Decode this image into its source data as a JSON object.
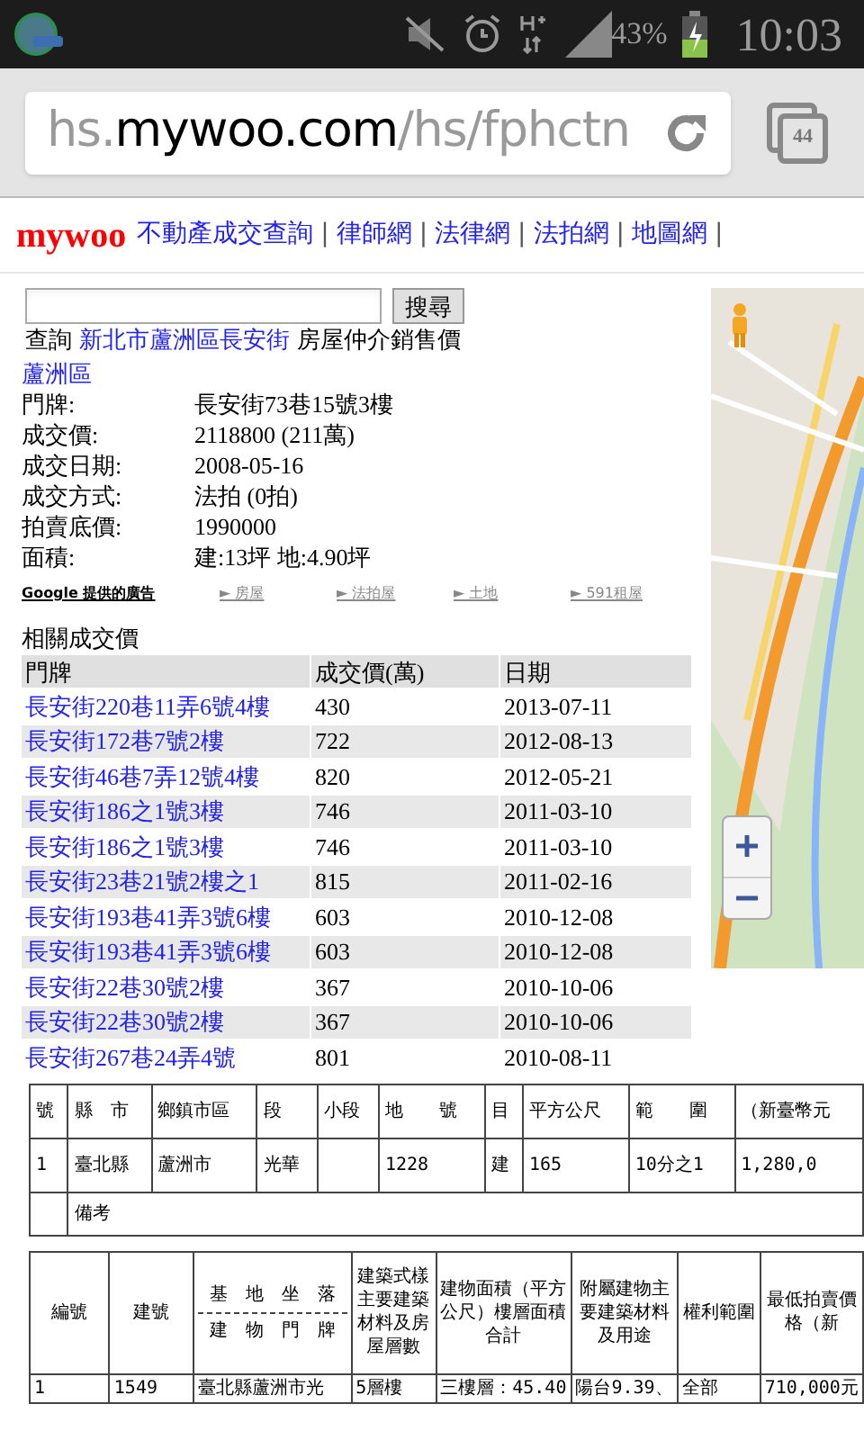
{
  "status_bar": {
    "battery": "43%",
    "time": "10:03"
  },
  "browser": {
    "url_prefix": "hs.",
    "url_domain": "mywoo.com",
    "url_path": "/hs/fphctn",
    "tab_count": "44"
  },
  "header": {
    "logo": "mywoo",
    "separator": "|",
    "links": [
      "不動產成交查詢",
      "律師網",
      "法律網",
      "法拍網",
      "地圖網"
    ]
  },
  "search": {
    "button": "搜尋"
  },
  "query": {
    "prefix": "查詢",
    "link": "新北市蘆洲區長安街",
    "suffix": "房屋仲介銷售價"
  },
  "district": "蘆洲區",
  "details": [
    {
      "label": "門牌:",
      "value": "長安街73巷15號3樓"
    },
    {
      "label": "成交價:",
      "value": "2118800 (211萬)"
    },
    {
      "label": "成交日期:",
      "value": "2008-05-16"
    },
    {
      "label": "成交方式:",
      "value": "法拍 (0拍)"
    },
    {
      "label": "拍賣底價:",
      "value": "1990000"
    },
    {
      "label": "面積:",
      "value": "建:13坪 地:4.90坪"
    }
  ],
  "ads": {
    "label": "Google 提供的廣告",
    "links": [
      "► 房屋",
      "► 法拍屋",
      "► 土地",
      "► 591租屋"
    ]
  },
  "related": {
    "title": "相關成交價",
    "columns": [
      "門牌",
      "成交價(萬)",
      "日期"
    ],
    "rows": [
      [
        "長安街220巷11弄6號4樓",
        "430",
        "2013-07-11"
      ],
      [
        "長安街172巷7號2樓",
        "722",
        "2012-08-13"
      ],
      [
        "長安街46巷7弄12號4樓",
        "820",
        "2012-05-21"
      ],
      [
        "長安街186之1號3樓",
        "746",
        "2011-03-10"
      ],
      [
        "長安街186之1號3樓",
        "746",
        "2011-03-10"
      ],
      [
        "長安街23巷21號2樓之1",
        "815",
        "2011-02-16"
      ],
      [
        "長安街193巷41弄3號6樓",
        "603",
        "2010-12-08"
      ],
      [
        "長安街193巷41弄3號6樓",
        "603",
        "2010-12-08"
      ],
      [
        "長安街22巷30號2樓",
        "367",
        "2010-10-06"
      ],
      [
        "長安街22巷30號2樓",
        "367",
        "2010-10-06"
      ],
      [
        "長安街267巷24弄4號",
        "801",
        "2010-08-11"
      ]
    ]
  },
  "land_table": {
    "rows": [
      [
        "號",
        "縣　市",
        "鄉鎮市區",
        "段",
        "小段",
        "地　　號",
        "目",
        "平方公尺",
        "範　　圍",
        "（新臺幣元"
      ],
      [
        "1",
        "臺北縣",
        "蘆洲市",
        "光華",
        "",
        "1228",
        "建",
        "165",
        "10分之1",
        "1,280,0"
      ]
    ],
    "note": "備考"
  },
  "building_table": {
    "columns": [
      {
        "label": "編號"
      },
      {
        "label": "建號"
      },
      {
        "label": "基　地　坐　落",
        "sublabel": "建　物　門　牌"
      },
      {
        "label": "建築式樣主要建築材料及房屋層數"
      },
      {
        "label": "建物面積（平方公尺）樓層面積合計"
      },
      {
        "label": "附屬建物主要建築材料及用途"
      },
      {
        "label": "權利範圍"
      },
      {
        "label": "最低拍賣價格（新"
      }
    ],
    "rows": [
      [
        "1",
        "1549",
        "臺北縣蘆洲市光",
        "5層樓",
        "三樓層：45.40",
        "陽台9.39、",
        "全部",
        "710,000元"
      ]
    ]
  }
}
